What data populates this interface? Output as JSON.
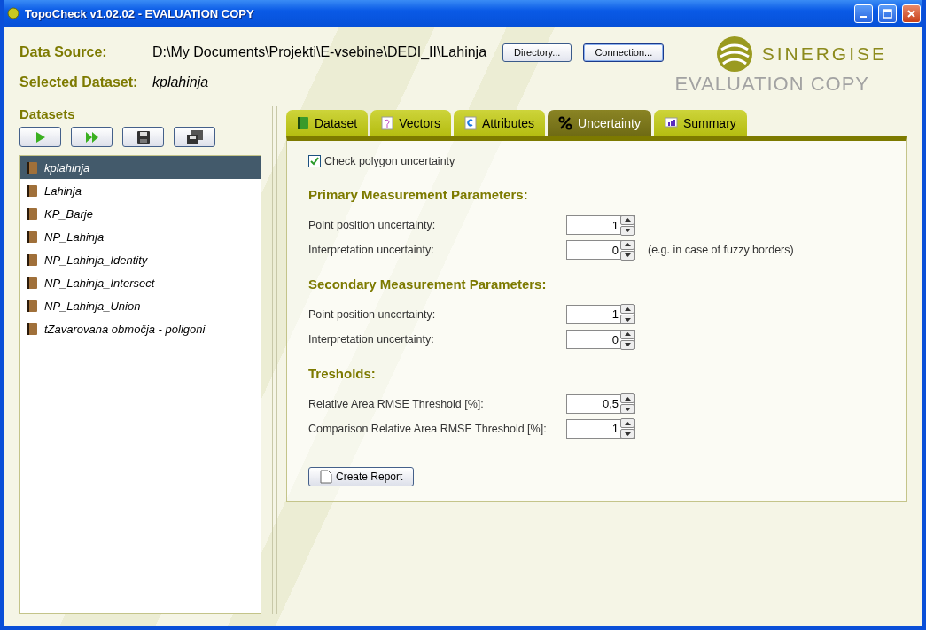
{
  "window": {
    "title": "TopoCheck v1.02.02 - EVALUATION COPY"
  },
  "header": {
    "data_source_label": "Data Source:",
    "data_source_path": "D:\\My Documents\\Projekti\\E-vsebine\\DEDI_II\\Lahinja",
    "buttons": [
      {
        "label": "Directory...",
        "focused": false
      },
      {
        "label": "Connection...",
        "focused": true
      }
    ],
    "selected_dataset_label": "Selected Dataset:",
    "selected_dataset": "kplahinja"
  },
  "logo": {
    "name": "SINERGISE",
    "notice": "EVALUATION COPY"
  },
  "datasets": {
    "title": "Datasets",
    "items": [
      {
        "label": "kplahinja",
        "selected": true
      },
      {
        "label": "Lahinja",
        "selected": false
      },
      {
        "label": "KP_Barje",
        "selected": false
      },
      {
        "label": "NP_Lahinja",
        "selected": false
      },
      {
        "label": "NP_Lahinja_Identity",
        "selected": false
      },
      {
        "label": "NP_Lahinja_Intersect",
        "selected": false
      },
      {
        "label": "NP_Lahinja_Union",
        "selected": false
      },
      {
        "label": "tZavarovana območja - poligoni",
        "selected": false
      }
    ]
  },
  "tabs": [
    {
      "label": "Dataset",
      "selected": false,
      "kind": "dataset"
    },
    {
      "label": "Vectors",
      "selected": false,
      "kind": "vectors"
    },
    {
      "label": "Attributes",
      "selected": false,
      "kind": "attributes"
    },
    {
      "label": "Uncertainty",
      "selected": true,
      "kind": "percent"
    },
    {
      "label": "Summary",
      "selected": false,
      "kind": "summary"
    }
  ],
  "uncertainty": {
    "check": {
      "label": "Check polygon uncertainty",
      "checked": true
    },
    "sections": [
      {
        "title": "Primary Measurement Parameters:",
        "rows": [
          {
            "label": "Point position uncertainty:",
            "value": "1"
          },
          {
            "label": "Interpretation uncertainty:",
            "value": "0",
            "note": "(e.g. in case of fuzzy borders)"
          }
        ]
      },
      {
        "title": "Secondary Measurement Parameters:",
        "rows": [
          {
            "label": "Point position uncertainty:",
            "value": "1"
          },
          {
            "label": "Interpretation uncertainty:",
            "value": "0"
          }
        ]
      },
      {
        "title": "Tresholds:",
        "rows": [
          {
            "label": "Relative Area RMSE Threshold [%]:",
            "value": "0,5"
          },
          {
            "label": "Comparison Relative Area RMSE Threshold [%]:",
            "value": "1"
          }
        ]
      }
    ],
    "report_button": "Create Report"
  }
}
